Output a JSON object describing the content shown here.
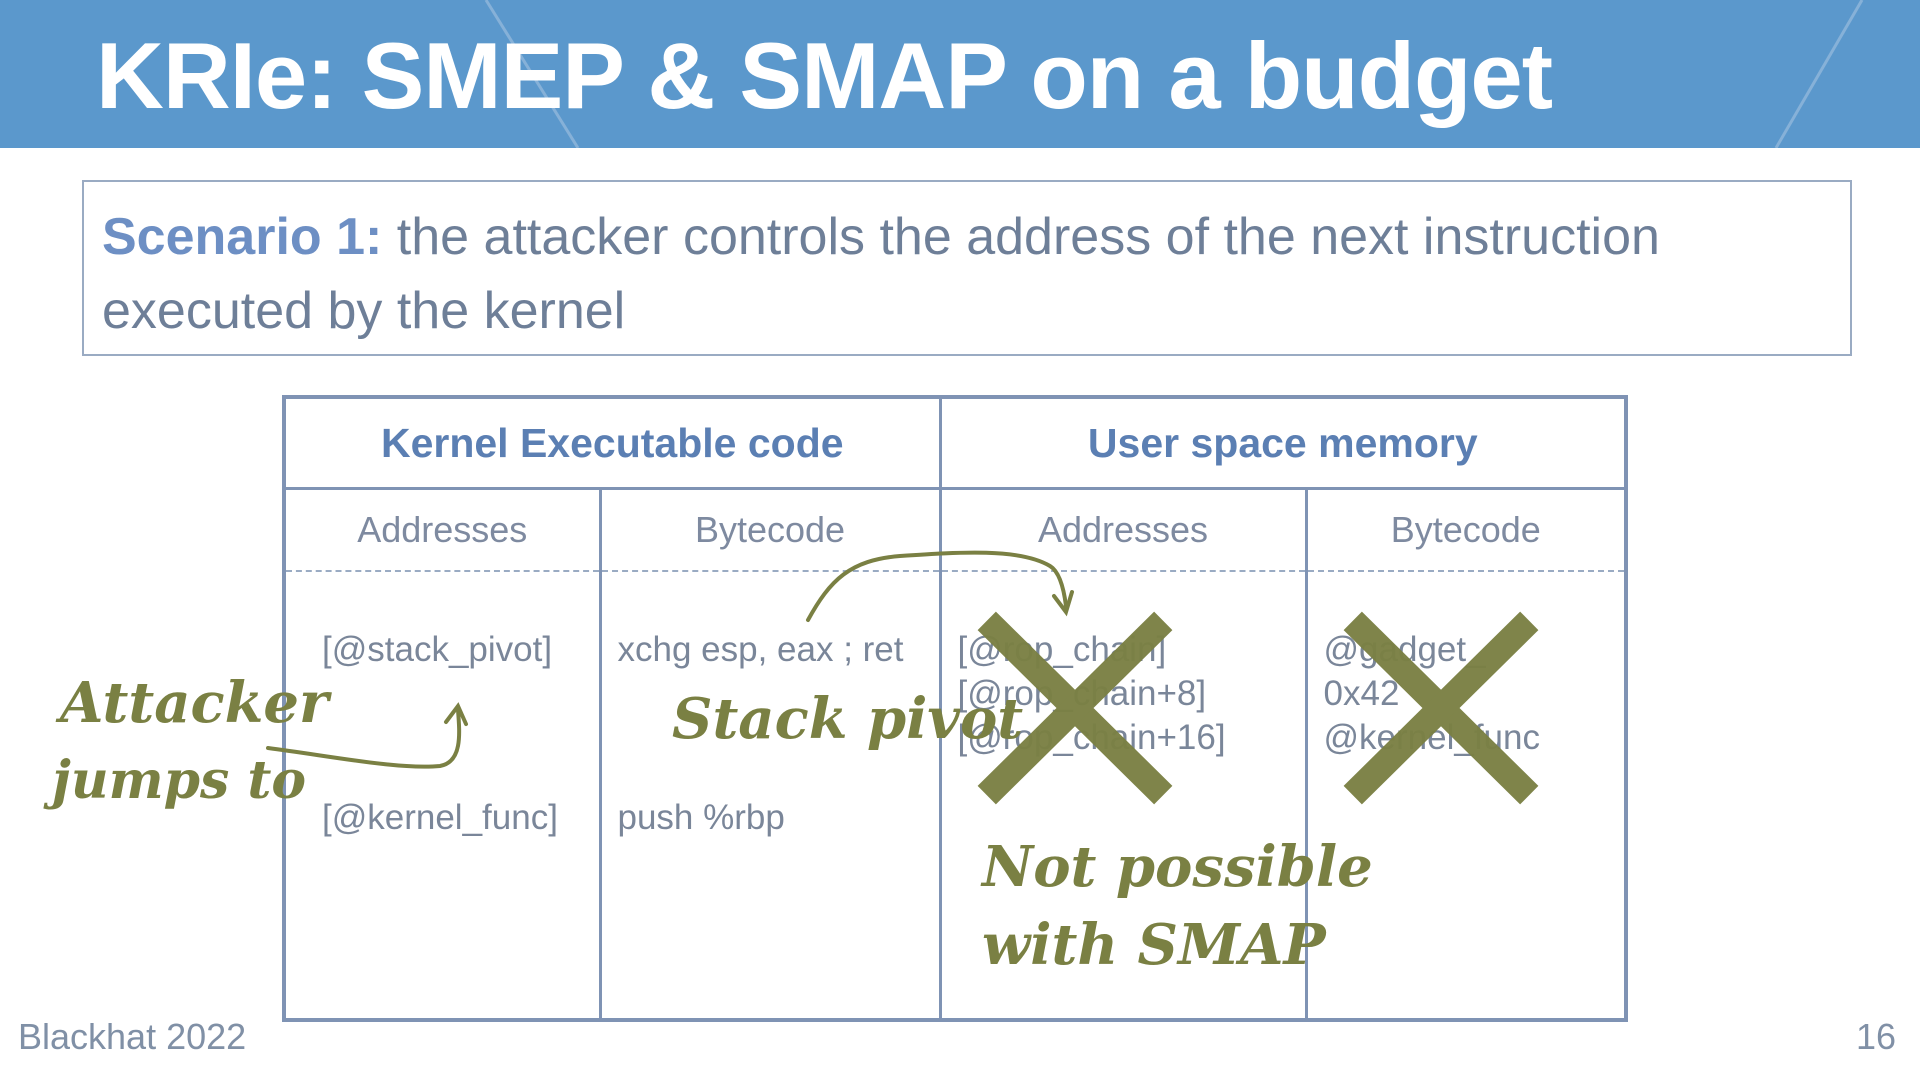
{
  "slide": {
    "title": "KRIe: SMEP & SMAP on a budget",
    "scenario": {
      "label": "Scenario 1:",
      "text": " the attacker controls the address of the next instruction executed by the kernel"
    },
    "table": {
      "group_headers": [
        "Kernel Executable code",
        "User space memory"
      ],
      "column_headers": [
        "Addresses",
        "Bytecode",
        "Addresses",
        "Bytecode"
      ],
      "kernel_addresses": [
        "[@stack_pivot]",
        "[@kernel_func]"
      ],
      "kernel_bytecode": [
        "xchg esp, eax ; ret",
        "push %rbp"
      ],
      "user_addresses": [
        "[@rop_chain]",
        "[@rop_chain+8]",
        "[@rop_chain+16]"
      ],
      "user_bytecode": [
        "@gadget_",
        "0x42",
        "@kernel_func"
      ]
    },
    "annotations": {
      "attacker_line1": "Attacker",
      "attacker_line2": "jumps to",
      "stack_pivot": "Stack pivot",
      "not_possible_line1": "Not possible",
      "not_possible_line2": "with SMAP"
    },
    "footer": {
      "event": "Blackhat 2022",
      "page_number": "16"
    },
    "colors": {
      "banner": "#5b98cc",
      "accent_olive": "#7a8043",
      "table_border": "#7f93b4",
      "header_text": "#5b7fb3"
    },
    "icons": [
      "cross-mark-icon",
      "curved-arrow-icon"
    ]
  }
}
